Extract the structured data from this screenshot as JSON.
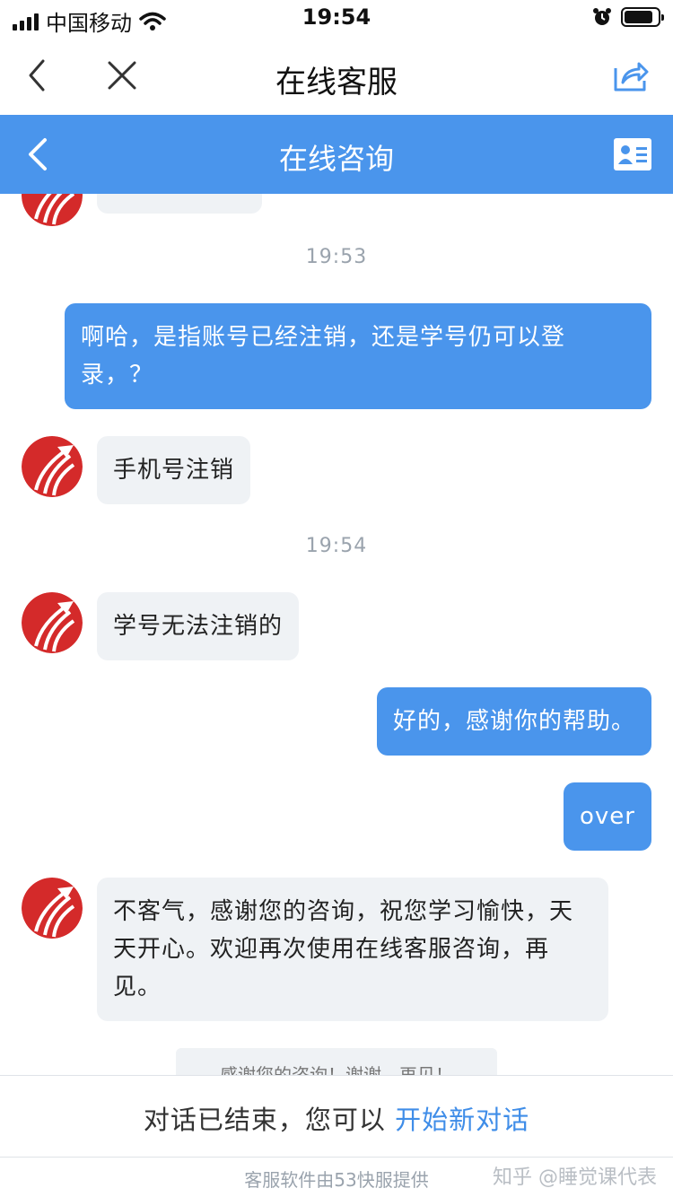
{
  "status_bar": {
    "carrier": "中国移动",
    "time": "19:54",
    "icons": [
      "signal-icon",
      "wifi-icon",
      "alarm-icon",
      "battery-icon"
    ]
  },
  "title_bar": {
    "title": "在线客服",
    "icons": [
      "back-arrow-icon",
      "close-icon",
      "share-icon"
    ]
  },
  "chat_header": {
    "title": "在线咨询",
    "icons": [
      "back-arrow-icon",
      "contact-card-icon"
    ],
    "color": "#4a95ec"
  },
  "chat": {
    "timestamps": [
      "19:53",
      "19:54"
    ],
    "messages": [
      {
        "from": "user",
        "text": "啊哈，是指账号已经注销，还是学号仍可以登录，？"
      },
      {
        "from": "agent",
        "text": "手机号注销"
      },
      {
        "from": "agent",
        "text": "学号无法注销的"
      },
      {
        "from": "user",
        "text": "好的，感谢你的帮助。"
      },
      {
        "from": "user",
        "text": "over"
      },
      {
        "from": "agent",
        "text": "不客气，感谢您的咨询，祝您学习愉快，天天开心。欢迎再次使用在线客服咨询，再见。"
      }
    ],
    "system_note": "感谢您的咨询！谢谢，再见！"
  },
  "end_bar": {
    "text": "对话已结束，您可以",
    "link": "开始新对话"
  },
  "footer": {
    "powered_by": "客服软件由53快服提供",
    "watermark": "知乎 @睡觉课代表"
  }
}
